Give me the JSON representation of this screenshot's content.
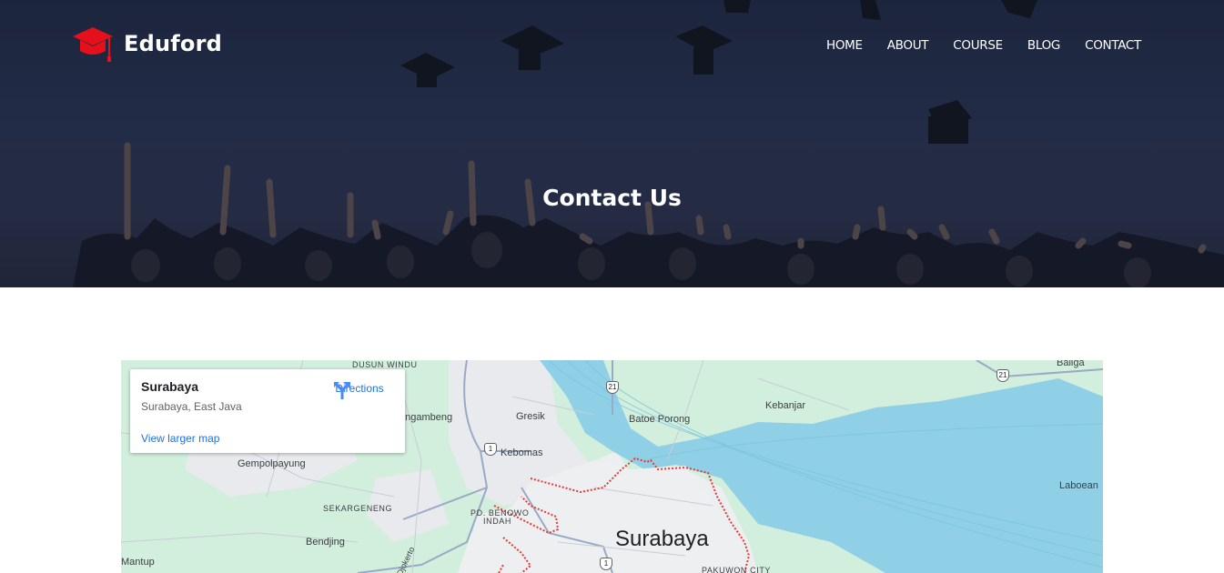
{
  "brand": {
    "name": "Eduford",
    "accent": "#e5101b"
  },
  "nav": {
    "items": [
      "HOME",
      "ABOUT",
      "COURSE",
      "BLOG",
      "CONTACT"
    ]
  },
  "hero": {
    "title": "Contact Us"
  },
  "map": {
    "card": {
      "title": "Surabaya",
      "subtitle": "Surabaya, East Java",
      "directions_label": "Directions",
      "larger_map_label": "View larger map"
    },
    "labels": {
      "dusun_windu": "DUSUN WINDU",
      "gresik": "Gresik",
      "batoe_porong": "Batoe Porong",
      "kebanjar": "Kebanjar",
      "baliga": "Baliga",
      "kebomas": "Kebomas",
      "gempolpayung": "Gempolpayung",
      "sekargeneng": "SEKARGENENG",
      "pd_benowo": "PD. BENOWO",
      "indah": "INDAH",
      "bendjing": "Bendjing",
      "mantup": "Mantup",
      "surabaya": "Surabaya",
      "laboean": "Laboean",
      "pakuwon": "PAKUWON CITY",
      "djokerto": "Djokerto",
      "ngambeng": "engambeng"
    },
    "shields": {
      "r21a": "21",
      "r21b": "21",
      "r1a": "1",
      "r1b": "1"
    },
    "colors": {
      "water": "#8fd0e6",
      "land": "#d2eedd",
      "urban": "#e8eaed",
      "boundary": "#e53935",
      "road": "#9aa9c5"
    }
  }
}
